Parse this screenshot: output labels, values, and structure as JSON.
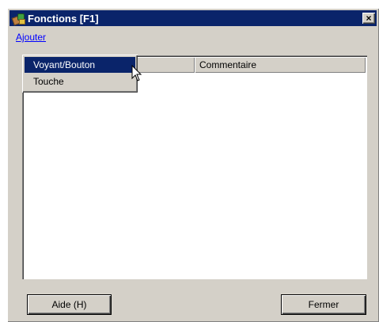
{
  "window": {
    "title": "Fonctions [F1]",
    "close_label": "×"
  },
  "toolbar": {
    "add_link": "Ajouter"
  },
  "list": {
    "columns": [
      "",
      "Commentaire"
    ]
  },
  "menu": {
    "items": [
      "Voyant/Bouton",
      "Touche"
    ],
    "selected": "Voyant/Bouton"
  },
  "buttons": {
    "help_label": "Aide (H)",
    "close_label": "Fermer"
  },
  "colors": {
    "titlebar": "#0a246a",
    "face": "#d4d0c8",
    "link": "#0000ff"
  }
}
